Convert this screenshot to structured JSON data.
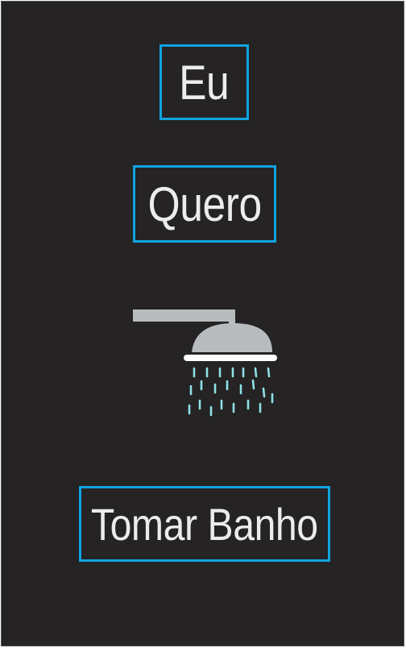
{
  "words": {
    "eu": "Eu",
    "quero": "Quero",
    "tomar_banho": "Tomar Banho"
  },
  "icon": {
    "name": "shower-icon"
  },
  "colors": {
    "background": "#252324",
    "box_border": "#0fa3e0",
    "text": "#ececec",
    "shower_metal": "#b9bcbf",
    "water_drops": "#8fe0e6"
  }
}
